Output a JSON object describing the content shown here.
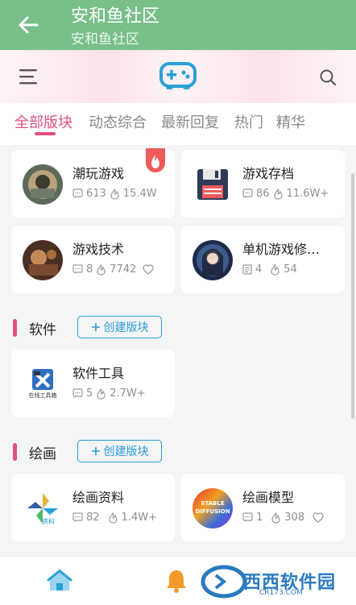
{
  "appbar": {
    "title": "安和鱼社区",
    "subtitle": "安和鱼社区"
  },
  "tabs": [
    {
      "label": "全部版块",
      "active": true
    },
    {
      "label": "动态综合",
      "active": false
    },
    {
      "label": "最新回复",
      "active": false
    },
    {
      "label": "热门",
      "active": false
    },
    {
      "label": "精华",
      "active": false
    }
  ],
  "cards": {
    "c1": {
      "name": "潮玩游戏",
      "posts": "613",
      "heat": "15.4W",
      "hot": true
    },
    "c2": {
      "name": "游戏存档",
      "posts": "86",
      "heat": "11.6W+"
    },
    "c3": {
      "name": "游戏技术",
      "posts": "8",
      "heat": "7742"
    },
    "c4": {
      "name": "单机游戏修…",
      "posts": "4",
      "heat": "54"
    },
    "c5": {
      "name": "软件工具",
      "posts": "5",
      "heat": "2.7W+",
      "logo_text": "在线工具箱"
    },
    "c6": {
      "name": "绘画资料",
      "posts": "82",
      "heat": "1.4W+",
      "logo_text": "资料"
    },
    "c7": {
      "name": "绘画模型",
      "posts": "1",
      "heat": "308",
      "logo_text": "STABLE DIFFUSION"
    }
  },
  "sections": {
    "software": {
      "title": "软件",
      "create_label": "创建版块"
    },
    "drawing": {
      "title": "绘画",
      "create_label": "创建版块"
    }
  },
  "watermark": {
    "text": "西西软件园",
    "small": "CR173.COM"
  },
  "colors": {
    "appbar": "#78bf8a",
    "accent": "#e0507f",
    "link": "#2a9bd8"
  }
}
